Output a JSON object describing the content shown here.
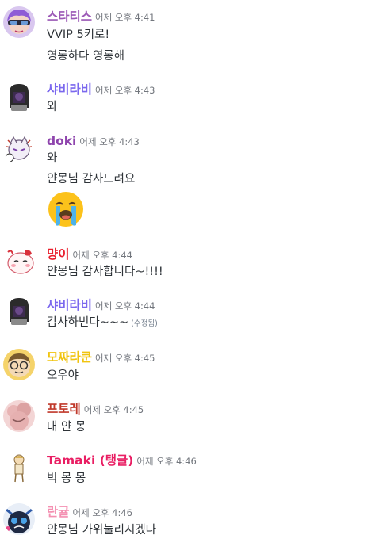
{
  "colors": {
    "username_1": "#9b59b6",
    "username_2": "#7b68ee",
    "username_3": "#8e44ad",
    "username_4": "#e91e2c",
    "username_6": "#f1c40f",
    "username_7": "#c0392b",
    "username_8": "#e91e63",
    "username_9": "#f48fb1",
    "timestamp": "#72767d",
    "text": "#2e3338"
  },
  "messages": [
    {
      "username": "스타티스",
      "timestamp": "어제 오후 4:41",
      "lines": [
        "VVIP 5키로!",
        "영롱하다 영롱해"
      ],
      "avatar": "purple-hair-avatar"
    },
    {
      "username": "샤비라비",
      "timestamp": "어제 오후 4:43",
      "lines": [
        "와"
      ],
      "avatar": "dark-hood-avatar"
    },
    {
      "username": "doki",
      "timestamp": "어제 오후 4:43",
      "lines": [
        "와",
        "얀몽님 감사드려요"
      ],
      "emoji": "loudly-crying-face",
      "avatar": "white-cat-avatar"
    },
    {
      "username": "먕이",
      "timestamp": "어제 오후 4:44",
      "lines": [
        "얀몽님 감사합니다~!!!!"
      ],
      "avatar": "pink-blob-avatar"
    },
    {
      "username": "샤비라비",
      "timestamp": "어제 오후 4:44",
      "lines": [
        "감사하빈다~~~"
      ],
      "edited": "(수정됨)",
      "avatar": "dark-hood-avatar"
    },
    {
      "username": "모짜라쿤",
      "timestamp": "어제 오후 4:45",
      "lines": [
        "오우야"
      ],
      "avatar": "glasses-face-avatar"
    },
    {
      "username": "프토레",
      "timestamp": "어제 오후 4:45",
      "lines": [
        "대 얀 몽"
      ],
      "avatar": "pink-fluffy-avatar"
    },
    {
      "username": "Tamaki (탱글)",
      "timestamp": "어제 오후 4:46",
      "lines": [
        "빅 몽 몽"
      ],
      "avatar": "standing-figure-avatar"
    },
    {
      "username": "란귤",
      "timestamp": "어제 오후 4:46",
      "lines": [
        "얀몽님 가위눌리시겠다"
      ],
      "avatar": "dark-creature-avatar"
    }
  ]
}
